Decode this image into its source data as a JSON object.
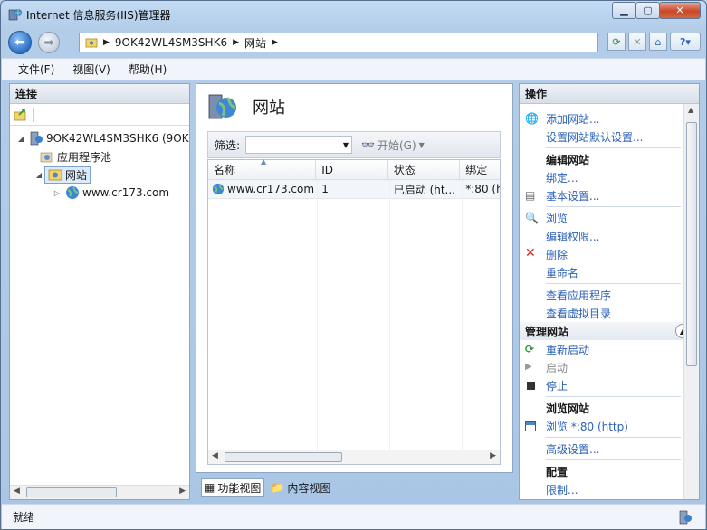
{
  "window": {
    "title": "Internet 信息服务(IIS)管理器"
  },
  "address": {
    "segments": [
      "9OK42WL4SM3SHK6",
      "网站"
    ]
  },
  "menu": {
    "items": [
      "文件(F)",
      "视图(V)",
      "帮助(H)"
    ]
  },
  "left": {
    "header": "连接",
    "tree": {
      "server": "9OK42WL4SM3SHK6 (9OK",
      "app_pools": "应用程序池",
      "sites": "网站",
      "site": "www.cr173.com"
    }
  },
  "center": {
    "title": "网站",
    "filter": {
      "label": "筛选:",
      "go": "开始(G)"
    },
    "columns": [
      "名称",
      "ID",
      "状态",
      "绑定"
    ],
    "rows": [
      {
        "name": "www.cr173.com",
        "id": "1",
        "status": "已启动 (ht...",
        "binding": "*:80 (h"
      }
    ],
    "tabs": {
      "feature": "功能视图",
      "content": "内容视图"
    }
  },
  "right": {
    "header": "操作",
    "add_site": "添加网站...",
    "site_defaults": "设置网站默认设置...",
    "edit_site_header": "编辑网站",
    "bindings": "绑定...",
    "basic_settings": "基本设置...",
    "browse": "浏览",
    "edit_permissions": "编辑权限...",
    "delete": "删除",
    "rename": "重命名",
    "view_apps": "查看应用程序",
    "view_vdirs": "查看虚拟目录",
    "manage_header": "管理网站",
    "restart": "重新启动",
    "start": "启动",
    "stop": "停止",
    "browse_site_header": "浏览网站",
    "browse_port": "浏览 *:80 (http)",
    "advanced": "高级设置...",
    "config_header": "配置",
    "limits": "限制..."
  },
  "status": {
    "text": "就绪"
  }
}
